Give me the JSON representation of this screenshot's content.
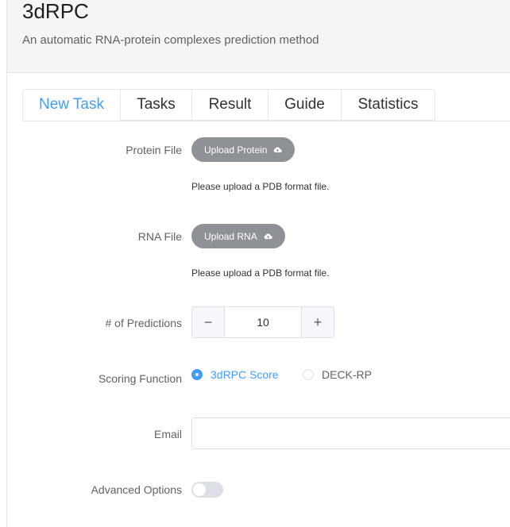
{
  "header": {
    "title": "3dRPC",
    "subtitle": "An automatic RNA-protein complexes prediction method"
  },
  "tabs": [
    {
      "label": "New Task",
      "active": true
    },
    {
      "label": "Tasks",
      "active": false
    },
    {
      "label": "Result",
      "active": false
    },
    {
      "label": "Guide",
      "active": false
    },
    {
      "label": "Statistics",
      "active": false
    }
  ],
  "form": {
    "protein": {
      "label": "Protein File",
      "button": "Upload Protein",
      "hint": "Please upload a PDB format file."
    },
    "rna": {
      "label": "RNA File",
      "button": "Upload RNA",
      "hint": "Please upload a PDB format file."
    },
    "predictions": {
      "label": "# of Predictions",
      "value": "10",
      "minus": "−",
      "plus": "+"
    },
    "scoring": {
      "label": "Scoring Function",
      "options": [
        {
          "label": "3dRPC Score",
          "selected": true
        },
        {
          "label": "DECK-RP",
          "selected": false
        }
      ]
    },
    "email": {
      "label": "Email",
      "value": "",
      "placeholder": ""
    },
    "advanced": {
      "label": "Advanced Options",
      "enabled": false
    }
  },
  "colors": {
    "accent": "#409eff",
    "upload_button": "#8e9196",
    "header_bg": "#f5f5f5"
  },
  "icons": {
    "upload": "cloud-upload-icon"
  }
}
